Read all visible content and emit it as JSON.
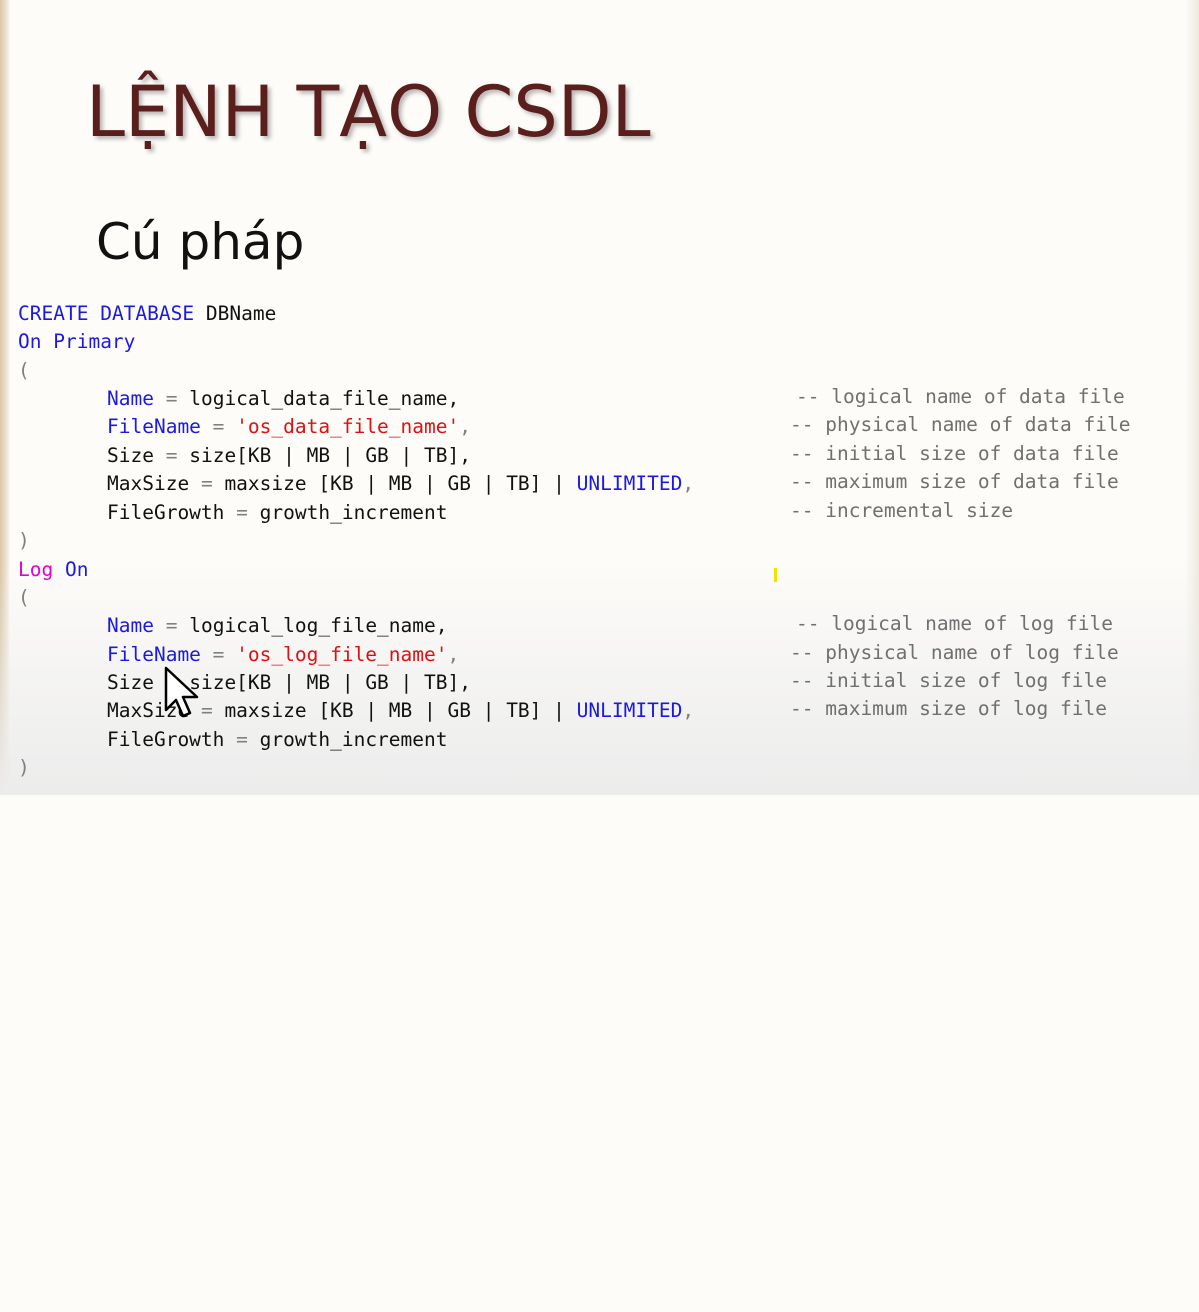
{
  "slide": {
    "title": "LỆNH TẠO CSDL",
    "subtitle": "Cú pháp"
  },
  "code": {
    "create": "CREATE",
    "database": "DATABASE",
    "dbname": "DBName",
    "on": "On",
    "primary": "Primary",
    "open_paren": "(",
    "close_paren": ")",
    "log": "Log",
    "log_on": "On",
    "unlimited": "UNLIMITED",
    "data": {
      "name_kw": "Name",
      "name_val": "logical_data_file_name,",
      "filename_kw": "FileName",
      "filename_val": "'os_data_file_name'",
      "size_kw": "Size",
      "size_val": "size[KB | MB | GB | TB],",
      "maxsize_kw": "MaxSize",
      "maxsize_val": "maxsize [KB | MB | GB | TB] |",
      "growth_kw": "FileGrowth",
      "growth_val": "growth_increment",
      "cmt_name": "-- logical name of data file",
      "cmt_filename": "-- physical name of data file",
      "cmt_size": "-- initial size of data file",
      "cmt_maxsize": "-- maximum size of data file",
      "cmt_growth": "-- incremental size"
    },
    "log_file": {
      "name_kw": "Name",
      "name_val": "logical_log_file_name,",
      "filename_kw": "FileName",
      "filename_val": "'os_log_file_name'",
      "size_kw": "Size",
      "size_val": "size[KB | MB | GB | TB],",
      "maxsize_kw": "MaxSize",
      "maxsize_val": "maxsize [KB | MB | GB | TB] |",
      "growth_kw": "FileGrowth",
      "growth_val": "growth_increment",
      "cmt_name": "-- logical name of log file",
      "cmt_filename": "-- physical name of log file",
      "cmt_size": "-- initial size of log file",
      "cmt_maxsize": "-- maximum size of log file"
    }
  },
  "colors": {
    "title": "#5a1f1d",
    "keyword": "#1a1ae0",
    "log_keyword": "#e000d8",
    "string": "#e01010",
    "comment": "#707070"
  }
}
